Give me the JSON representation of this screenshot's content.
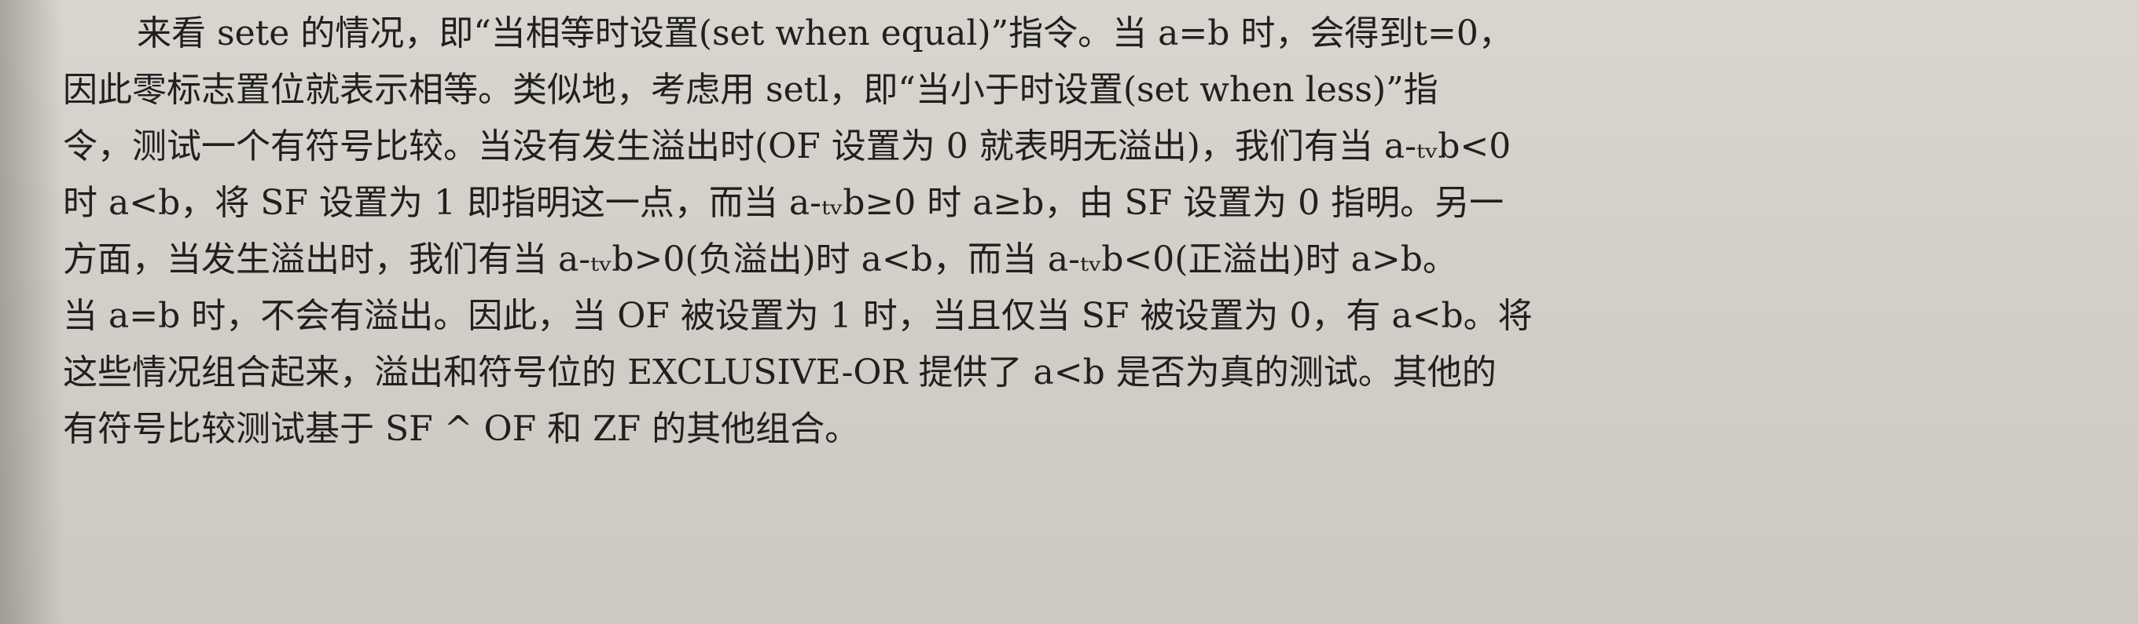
{
  "paragraph": {
    "lines": [
      "来看 sete 的情况，即“当相等时设置(set when equal)”指令。当 a=b 时，会得到t=0，",
      "因此零标志置位就表示相等。类似地，考虑用 setl，即“当小于时设置(set when less)”指",
      "令，测试一个有符号比较。当没有发生溢出时(OF 设置为 0 就表明无溢出)，我们有当 a-ₜᵥb<0",
      "时 a<b，将 SF 设置为 1 即指明这一点，而当 a-ₜᵥb≥0 时 a≥b，由 SF 设置为 0 指明。另一",
      "方面，当发生溢出时，我们有当 a-ₜᵥb>0(负溢出)时 a<b，而当 a-ₜᵥb<0(正溢出)时 a>b。",
      "当 a=b 时，不会有溢出。因此，当 OF 被设置为 1 时，当且仅当 SF 被设置为 0，有 a<b。将",
      "这些情况组合起来，溢出和符号位的 EXCLUSIVE-OR 提供了 a<b 是否为真的测试。其他的",
      "有符号比较测试基于 SF ^ OF 和 ZF 的其他组合。"
    ]
  }
}
